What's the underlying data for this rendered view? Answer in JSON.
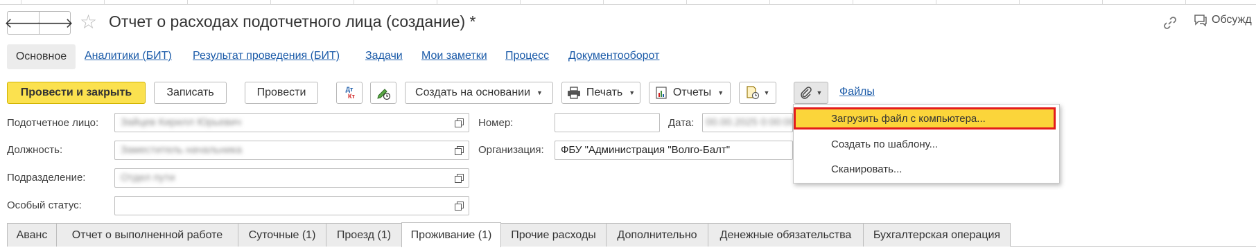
{
  "window": {
    "title": "Отчет о расходах подотчетного лица (создание) *",
    "discuss_label": "Обсужд"
  },
  "nav": {
    "back_icon": "arrow-left-icon",
    "forward_icon": "arrow-right-icon",
    "favorite_icon": "star-icon",
    "back_glyph": "🡐",
    "forward_glyph": "🡒",
    "star_glyph": "☆"
  },
  "sections": {
    "active": "Основное",
    "links": [
      "Аналитики (БИТ)",
      "Результат проведения (БИТ)",
      "Задачи",
      "Мои заметки",
      "Процесс",
      "Документооборот"
    ]
  },
  "toolbar": {
    "post_close": "Провести и закрыть",
    "save": "Записать",
    "post": "Провести",
    "dtkt_top": "Дт",
    "dtkt_bottom": "Кт",
    "create_based": "Создать на основании",
    "print": "Печать",
    "reports": "Отчеты",
    "files_link": "Файлы"
  },
  "form": {
    "accountable_label": "Подотчетное лицо:",
    "accountable_value": "Зайцев Кирилл Юрьевич",
    "position_label": "Должность:",
    "position_value": "Заместитель начальника",
    "department_label": "Подразделение:",
    "department_value": "Отдел пути",
    "status_label": "Особый статус:",
    "status_value": "",
    "number_label": "Номер:",
    "number_value": "",
    "date_label": "Дата:",
    "date_value": "00.00.2025 0:00:00",
    "org_label": "Организация:",
    "org_value": "ФБУ \"Администрация \"Волго-Балт\""
  },
  "attach_menu": {
    "items": [
      "Загрузить файл с компьютера...",
      "Создать по шаблону...",
      "Сканировать..."
    ],
    "highlighted_index": 0
  },
  "tabs": {
    "items": [
      "Аванс",
      "Отчет о выполненной работе",
      "Суточные (1)",
      "Проезд (1)",
      "Проживание (1)",
      "Прочие расходы",
      "Дополнительно",
      "Денежные обязательства",
      "Бухгалтерская операция"
    ],
    "active_index": 4
  },
  "colors": {
    "primary_button": "#fbe14f",
    "link": "#1a5aa8",
    "menu_highlight": "#fbd53a",
    "highlight_border": "#e31c1c"
  }
}
